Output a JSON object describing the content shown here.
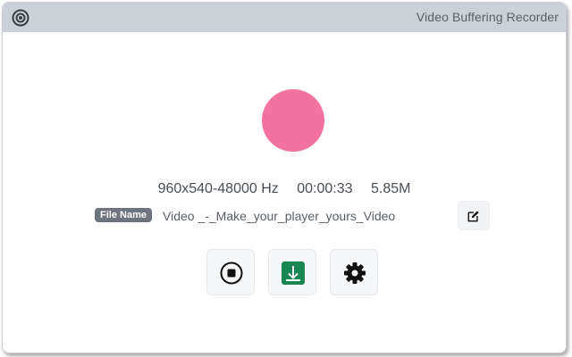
{
  "window": {
    "title": "Video Buffering Recorder"
  },
  "colors": {
    "titlebar": "#ccd1d8",
    "record_indicator": "#f2739f",
    "download_green": "#198754",
    "badge_gray": "#6c757d"
  },
  "stats": {
    "resolution": "960x540-48000 Hz",
    "duration": "00:00:33",
    "size": "5.85M"
  },
  "filename": {
    "label": "File Name",
    "value": "Video _-_Make_your_player_yours_Video"
  },
  "icons": {
    "app": "record-target-icon",
    "edit": "pencil-square-icon",
    "stop": "stop-circle-icon",
    "download": "download-arrow-icon",
    "settings": "gear-icon"
  }
}
